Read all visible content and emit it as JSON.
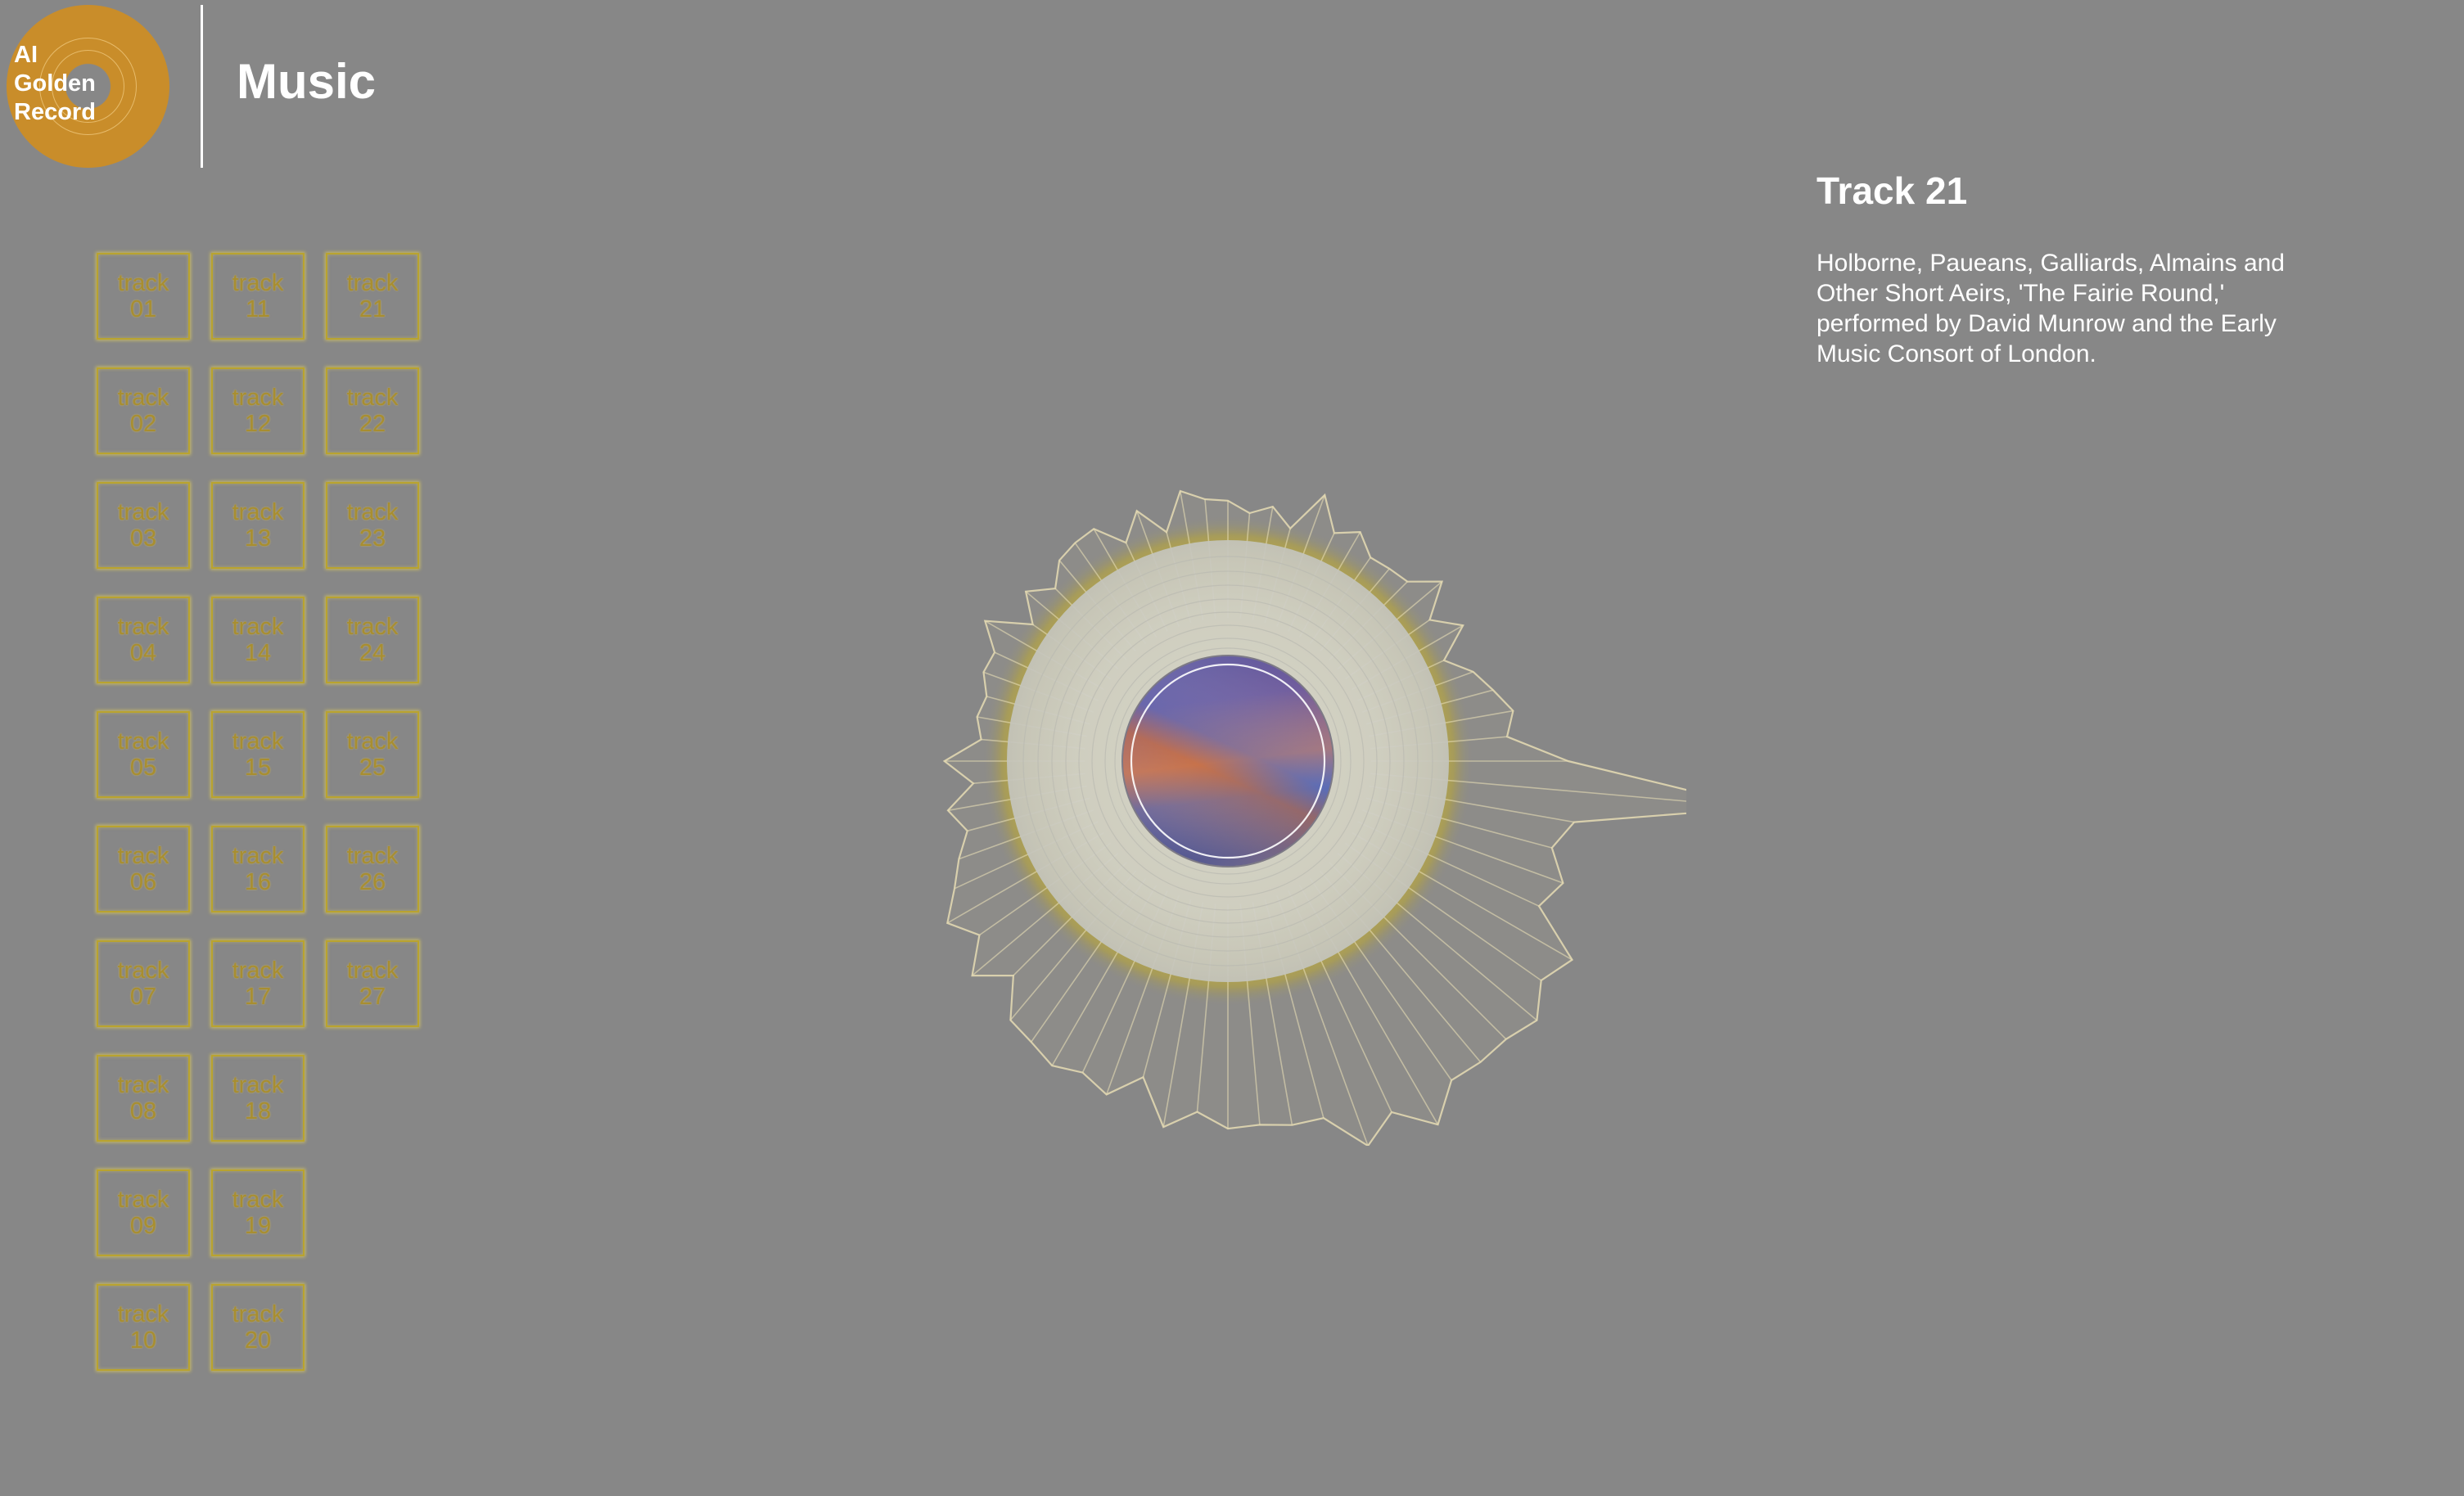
{
  "header": {
    "logo_line1": "AI",
    "logo_line2": "Golden",
    "logo_line3": "Record",
    "title": "Music"
  },
  "tracks": {
    "word": "track",
    "numbers": [
      "01",
      "02",
      "03",
      "04",
      "05",
      "06",
      "07",
      "08",
      "09",
      "10",
      "11",
      "12",
      "13",
      "14",
      "15",
      "16",
      "17",
      "18",
      "19",
      "20",
      "21",
      "22",
      "23",
      "24",
      "25",
      "26",
      "27"
    ],
    "active": "21"
  },
  "info": {
    "title": "Track 21",
    "description": "Holborne, Paueans, Galliards, Almains and Other Short Aeirs, 'The Fairie Round,' performed by David Munrow and the Early Music Consort of London."
  },
  "colors": {
    "background": "#878787",
    "accent_gold": "#c98d2a",
    "track_border": "#b9a32f",
    "track_text": "#a88e30",
    "disc_glow": "#c9b93a",
    "text": "#ffffff"
  },
  "icons": {
    "logo": "golden-record-disc",
    "visualizer": "audio-waveform-disc"
  }
}
